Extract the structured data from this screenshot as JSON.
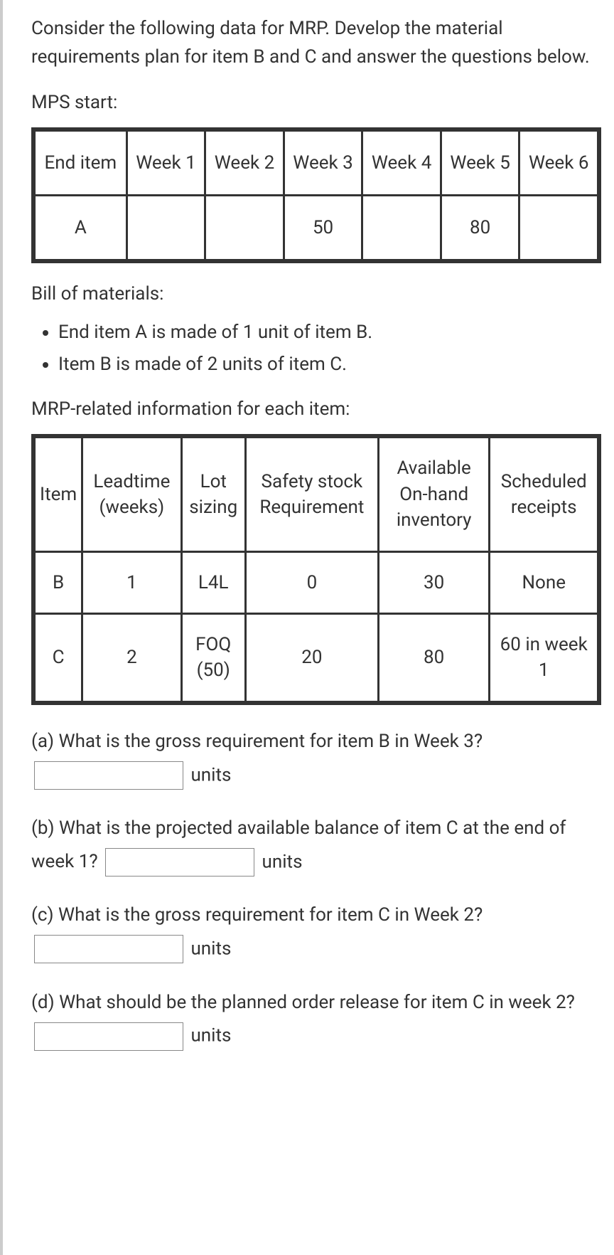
{
  "intro": "Consider the following data for MRP. Develop the material requirements plan for item B and C and answer the questions below.",
  "mps_label": "MPS start:",
  "mps_table": {
    "headers": [
      "End item",
      "Week 1",
      "Week 2",
      "Week 3",
      "Week 4",
      "Week 5",
      "Week 6"
    ],
    "rows": [
      {
        "item": "A",
        "cells": [
          "",
          "",
          "50",
          "",
          "80",
          ""
        ]
      }
    ]
  },
  "bom_label": "Bill of materials:",
  "bom_items": [
    "End item A is made of 1 unit of item B.",
    "Item B is made of 2 units of item C."
  ],
  "mrp_label": "MRP-related information for each item:",
  "mrp_table": {
    "headers": [
      "Item",
      "Leadtime (weeks)",
      "Lot sizing",
      "Safety stock Requirement",
      "Available On-hand inventory",
      "Scheduled receipts"
    ],
    "rows": [
      {
        "cells": [
          "B",
          "1",
          "L4L",
          "0",
          "30",
          "None"
        ]
      },
      {
        "cells": [
          "C",
          "2",
          "FOQ (50)",
          "20",
          "80",
          "60 in week 1"
        ]
      }
    ]
  },
  "questions": {
    "a": {
      "text": "(a) What is the gross requirement for item B in Week 3?",
      "units": "units"
    },
    "b": {
      "pre": "(b) What is the projected available balance of item C at the end of week 1?",
      "units": "units"
    },
    "c": {
      "text": "(c) What is the gross requirement for item C in Week 2?",
      "units": "units"
    },
    "d": {
      "pre": "(d) What should be the planned order release for item C in week 2?",
      "units": "units"
    }
  }
}
